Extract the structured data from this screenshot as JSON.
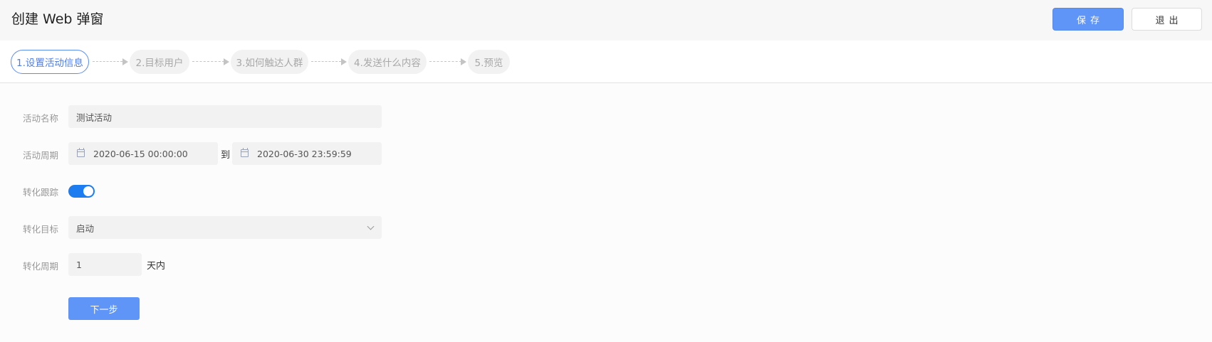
{
  "header": {
    "title": "创建 Web 弹窗",
    "save_label": "保存",
    "exit_label": "退出"
  },
  "steps": [
    {
      "label": "1.设置活动信息",
      "active": true
    },
    {
      "label": "2.目标用户",
      "active": false
    },
    {
      "label": "3.如何触达人群",
      "active": false
    },
    {
      "label": "4.发送什么内容",
      "active": false
    },
    {
      "label": "5.预览",
      "active": false
    }
  ],
  "form": {
    "activity_name": {
      "label": "活动名称",
      "value": "测试活动"
    },
    "activity_period": {
      "label": "活动周期",
      "start": "2020-06-15 00:00:00",
      "separator": "到",
      "end": "2020-06-30 23:59:59",
      "icon": "calendar-icon"
    },
    "conversion_tracking": {
      "label": "转化跟踪",
      "enabled": true
    },
    "conversion_goal": {
      "label": "转化目标",
      "value": "启动",
      "icon": "chevron-down-icon"
    },
    "conversion_period": {
      "label": "转化周期",
      "value": "1",
      "unit": "天内"
    },
    "next_label": "下一步"
  },
  "colors": {
    "primary": "#5f95f7",
    "toggle_on": "#1c7cf0",
    "step_active": "#5b8cf0"
  }
}
